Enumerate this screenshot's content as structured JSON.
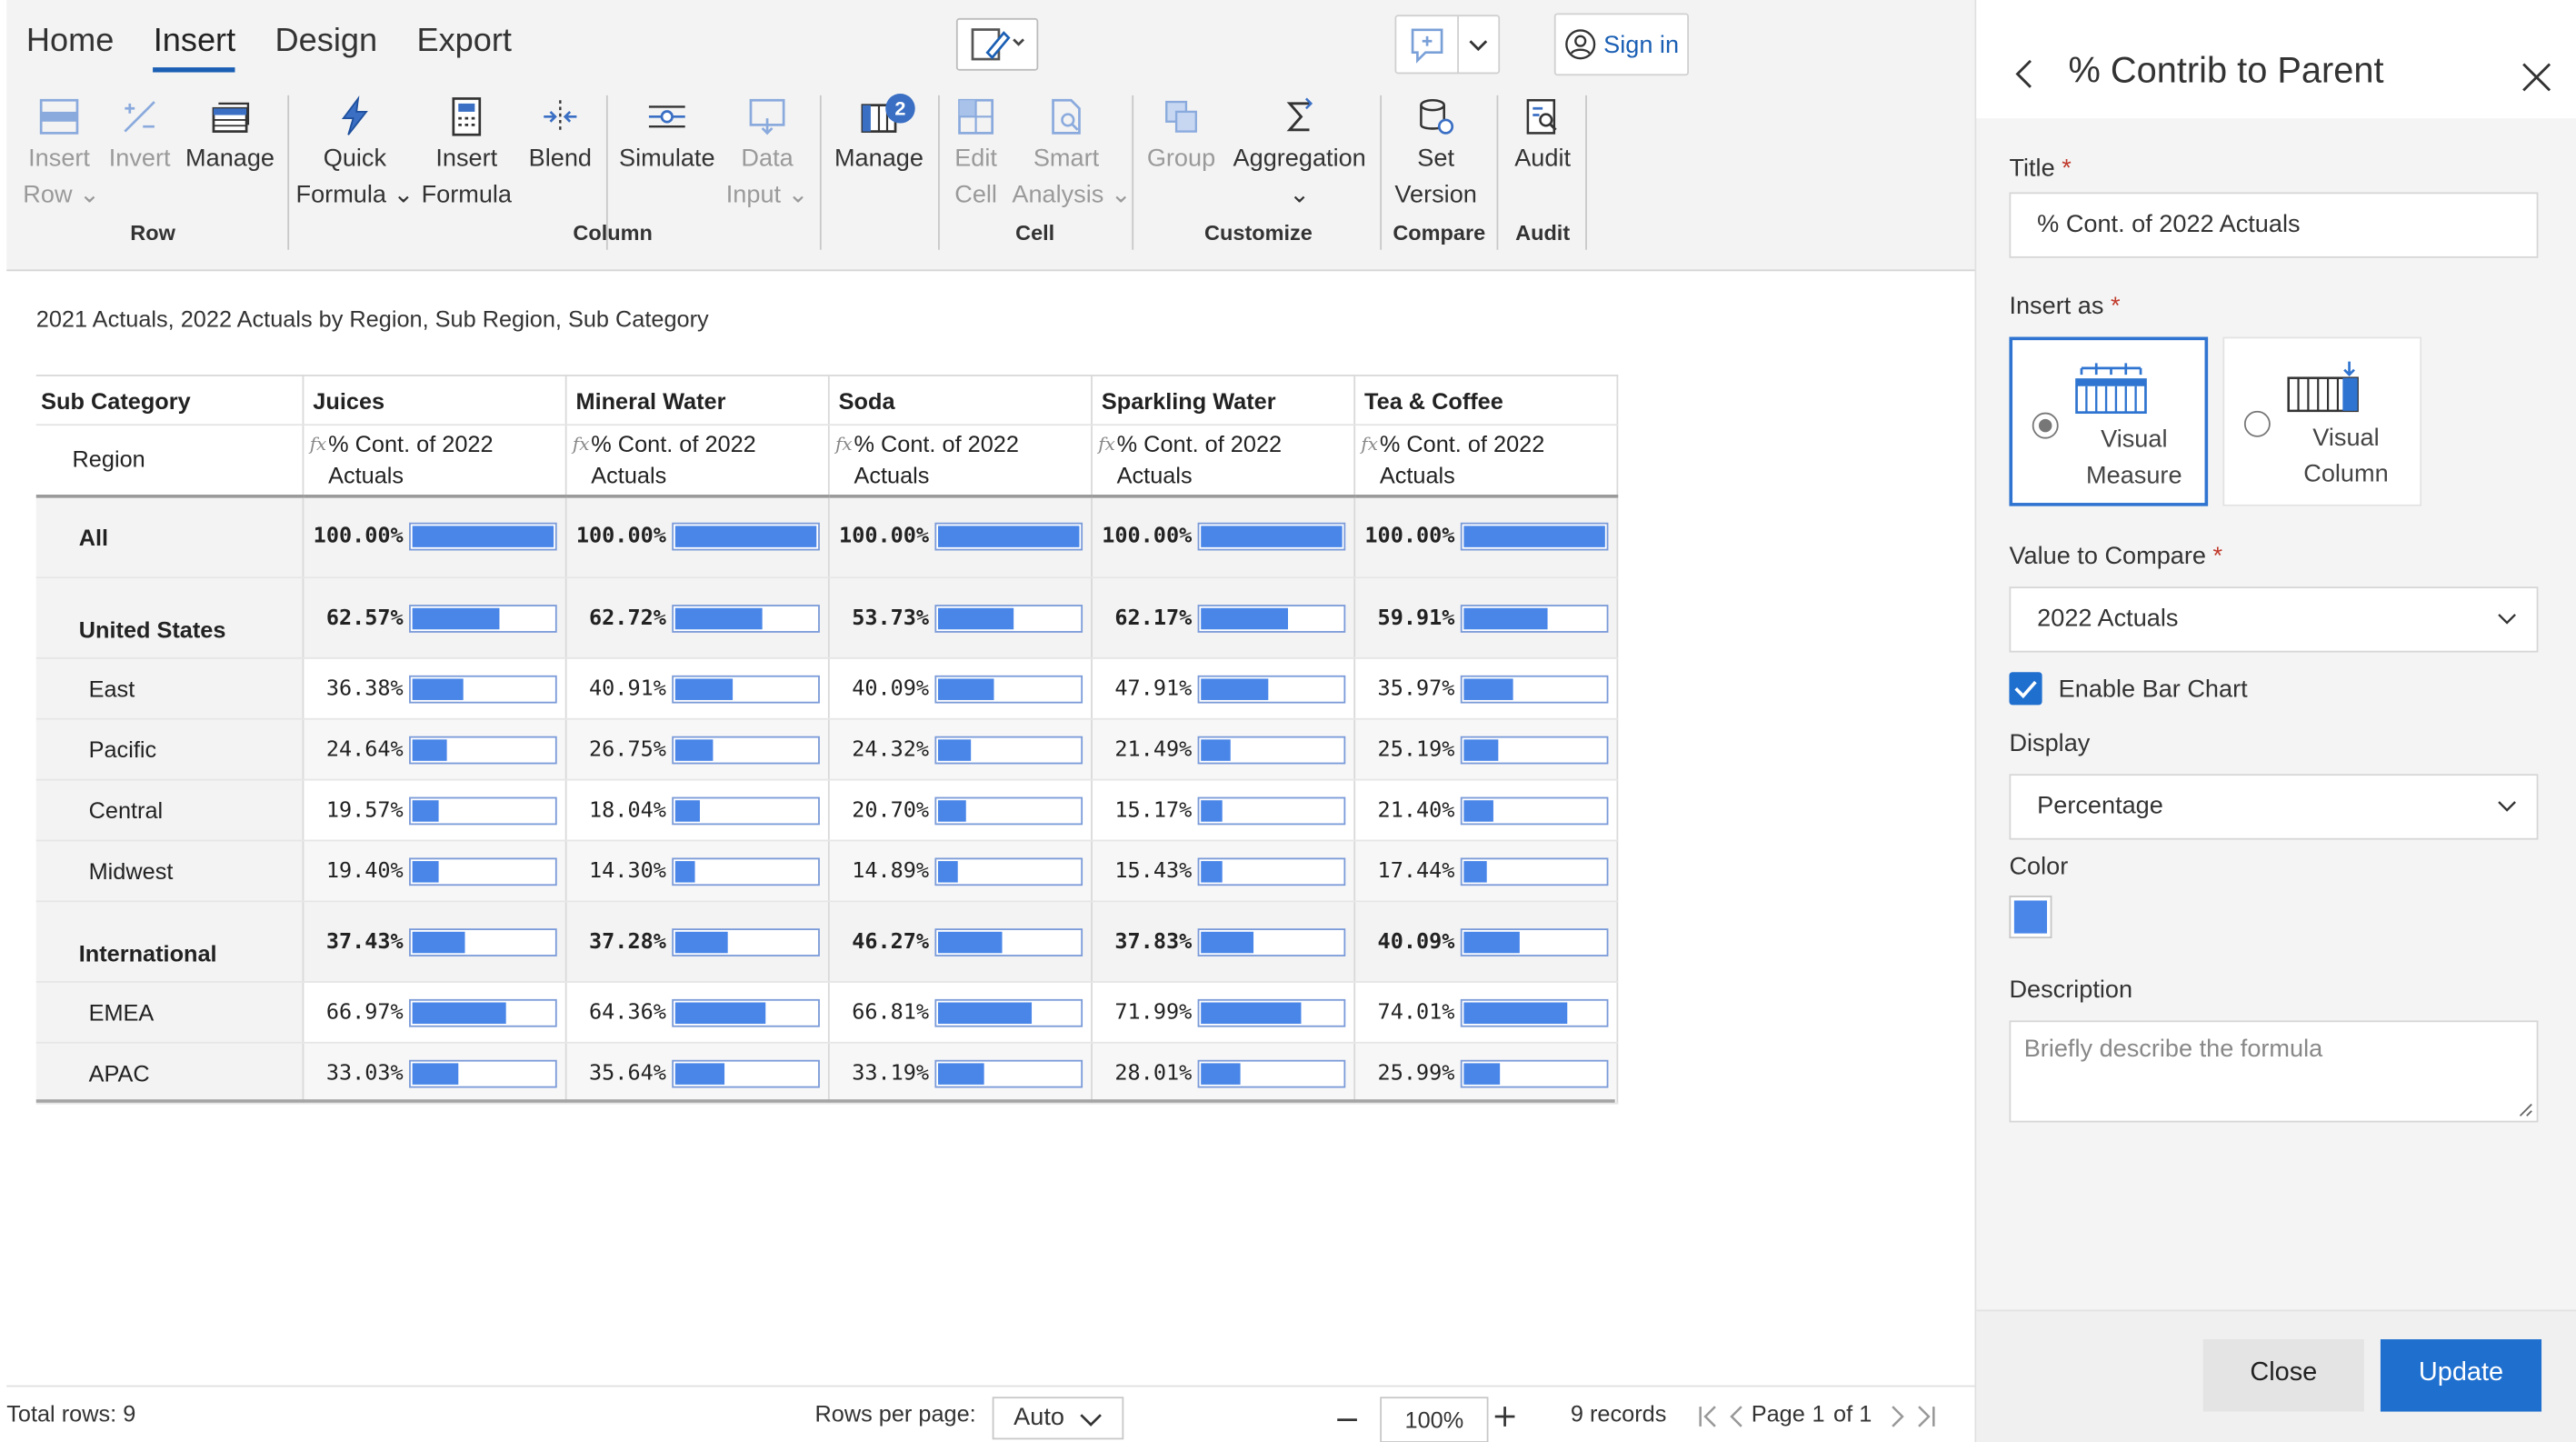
{
  "ribbon": {
    "tabs": [
      "Home",
      "Insert",
      "Design",
      "Export"
    ],
    "active_tab": "Insert",
    "signin_label": "Sign in",
    "groups": {
      "row": {
        "label": "Row",
        "insert_row": [
          "Insert",
          "Row"
        ],
        "invert": "Invert",
        "manage": "Manage"
      },
      "column": {
        "label": "Column",
        "quick_formula": [
          "Quick",
          "Formula"
        ],
        "insert_formula": [
          "Insert",
          "Formula"
        ],
        "blend": "Blend",
        "simulate": "Simulate",
        "data_input": [
          "Data",
          "Input"
        ],
        "manage": "Manage",
        "manage_badge": "2"
      },
      "cell": {
        "label": "Cell",
        "edit_cell": [
          "Edit",
          "Cell"
        ],
        "smart_analysis": [
          "Smart",
          "Analysis"
        ]
      },
      "customize": {
        "label": "Customize",
        "group": "Group",
        "aggregation": "Aggregation"
      },
      "compare": {
        "label": "Compare",
        "set_version": [
          "Set",
          "Version"
        ]
      },
      "audit": {
        "label": "Audit",
        "audit": "Audit"
      }
    }
  },
  "report": {
    "subtitle": "2021 Actuals, 2022 Actuals by Region, Sub Region, Sub Category",
    "row_header_1": "Sub Category",
    "row_header_2": "Region",
    "columns": [
      "Juices",
      "Mineral Water",
      "Soda",
      "Sparkling Water",
      "Tea & Coffee"
    ],
    "measure_line1": "% Cont. of 2022",
    "measure_line2": "Actuals",
    "rows": [
      {
        "label": "All",
        "values": [
          "100.00%",
          "100.00%",
          "100.00%",
          "100.00%",
          "100.00%"
        ],
        "fractions": [
          1.0,
          1.0,
          1.0,
          1.0,
          1.0
        ]
      },
      {
        "label": "United States",
        "values": [
          "62.57%",
          "62.72%",
          "53.73%",
          "62.17%",
          "59.91%"
        ],
        "fractions": [
          0.6257,
          0.6272,
          0.5373,
          0.6217,
          0.5991
        ]
      },
      {
        "label": "East",
        "values": [
          "36.38%",
          "40.91%",
          "40.09%",
          "47.91%",
          "35.97%"
        ],
        "fractions": [
          0.3638,
          0.4091,
          0.4009,
          0.4791,
          0.3597
        ]
      },
      {
        "label": "Pacific",
        "values": [
          "24.64%",
          "26.75%",
          "24.32%",
          "21.49%",
          "25.19%"
        ],
        "fractions": [
          0.2464,
          0.2675,
          0.2432,
          0.2149,
          0.2519
        ]
      },
      {
        "label": "Central",
        "values": [
          "19.57%",
          "18.04%",
          "20.70%",
          "15.17%",
          "21.40%"
        ],
        "fractions": [
          0.1957,
          0.1804,
          0.207,
          0.1517,
          0.214
        ]
      },
      {
        "label": "Midwest",
        "values": [
          "19.40%",
          "14.30%",
          "14.89%",
          "15.43%",
          "17.44%"
        ],
        "fractions": [
          0.194,
          0.143,
          0.1489,
          0.1543,
          0.1744
        ]
      },
      {
        "label": "International",
        "values": [
          "37.43%",
          "37.28%",
          "46.27%",
          "37.83%",
          "40.09%"
        ],
        "fractions": [
          0.3743,
          0.3728,
          0.4627,
          0.3783,
          0.4009
        ]
      },
      {
        "label": "EMEA",
        "values": [
          "66.97%",
          "64.36%",
          "66.81%",
          "71.99%",
          "74.01%"
        ],
        "fractions": [
          0.6697,
          0.6436,
          0.6681,
          0.7199,
          0.7401
        ]
      },
      {
        "label": "APAC",
        "values": [
          "33.03%",
          "35.64%",
          "33.19%",
          "28.01%",
          "25.99%"
        ],
        "fractions": [
          0.3303,
          0.3564,
          0.3319,
          0.2801,
          0.2599
        ]
      }
    ],
    "bar_color": "#4a86e8"
  },
  "footer": {
    "total_rows": "Total rows: 9",
    "rows_per_page_label": "Rows per page:",
    "rows_per_page_value": "Auto",
    "zoom": "100%",
    "records": "9 records",
    "page_label": "Page",
    "page_current": "1",
    "page_of": "of 1"
  },
  "panel": {
    "title": "% Contrib to Parent",
    "title_label": "Title",
    "title_value": "% Cont. of 2022 Actuals",
    "insert_as_label": "Insert as",
    "insert_options": [
      [
        "Visual",
        "Measure"
      ],
      [
        "Visual",
        "Column"
      ]
    ],
    "value_to_compare_label": "Value to Compare",
    "value_to_compare_value": "2022 Actuals",
    "enable_bar_chart_label": "Enable Bar Chart",
    "display_label": "Display",
    "display_value": "Percentage",
    "color_label": "Color",
    "color_value": "#4a86e8",
    "description_label": "Description",
    "description_placeholder": "Briefly describe the formula",
    "close_label": "Close",
    "update_label": "Update",
    "accent": "#1f6fcf"
  }
}
